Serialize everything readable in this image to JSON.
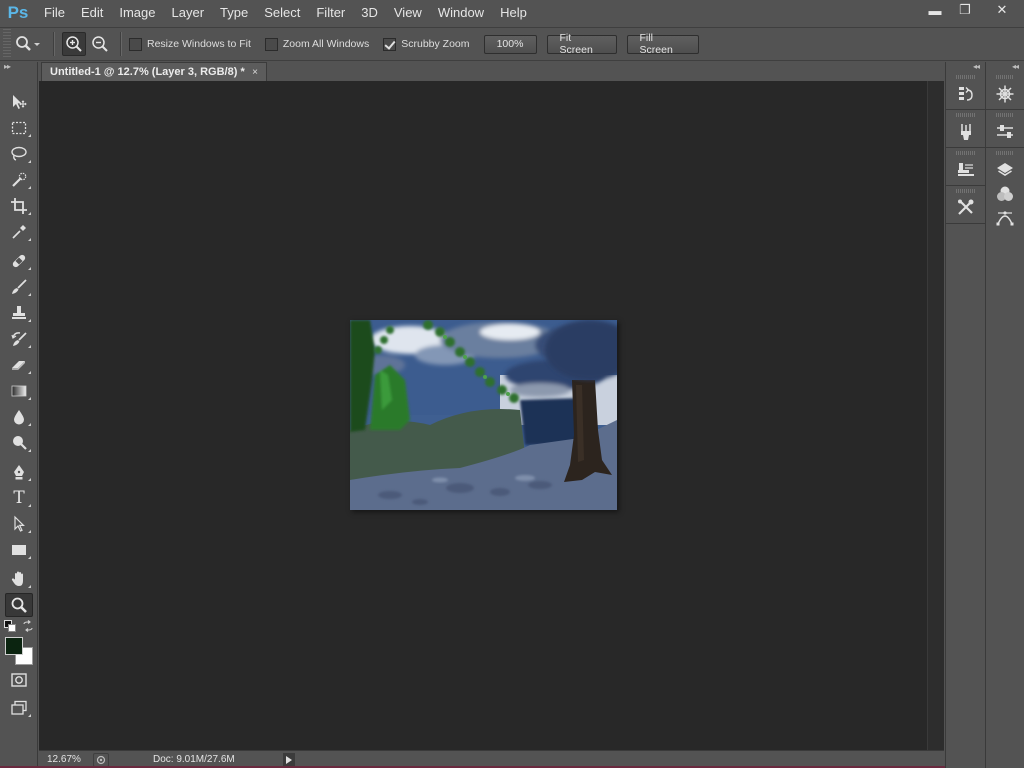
{
  "app": {
    "logo": "Ps"
  },
  "menu": [
    "File",
    "Edit",
    "Image",
    "Layer",
    "Type",
    "Select",
    "Filter",
    "3D",
    "View",
    "Window",
    "Help"
  ],
  "window_controls": {
    "minimize": "▬",
    "restore": "❐",
    "close": "✕"
  },
  "options_bar": {
    "tool_icon": "zoom-icon",
    "resize_windows_to_fit": {
      "label": "Resize Windows to Fit",
      "checked": false
    },
    "zoom_all_windows": {
      "label": "Zoom All Windows",
      "checked": false
    },
    "scrubby_zoom": {
      "label": "Scrubby Zoom",
      "checked": true
    },
    "buttons": {
      "actual_pixels": "100%",
      "fit_screen": "Fit Screen",
      "fill_screen": "Fill Screen"
    }
  },
  "document_tab": {
    "title": "Untitled-1 @ 12.7% (Layer 3, RGB/8) *",
    "close": "×"
  },
  "status_bar": {
    "zoom": "12.67%",
    "doc_size": "Doc: 9.01M/27.6M"
  },
  "colors": {
    "foreground": "#0b2410",
    "background": "#ffffff",
    "accent": "#5bb7e8"
  },
  "tools": [
    "move-tool",
    "marquee-tool",
    "lasso-tool",
    "quick-selection-tool",
    "crop-tool",
    "eyedropper-tool",
    "healing-brush-tool",
    "brush-tool",
    "clone-stamp-tool",
    "history-brush-tool",
    "eraser-tool",
    "gradient-tool",
    "blur-tool",
    "dodge-tool",
    "pen-tool",
    "type-tool",
    "path-selection-tool",
    "rectangle-tool",
    "hand-tool",
    "zoom-tool"
  ],
  "type_tool_glyph": "T",
  "collapse_glyph": "▸▸",
  "expand_glyph": "◂◂"
}
